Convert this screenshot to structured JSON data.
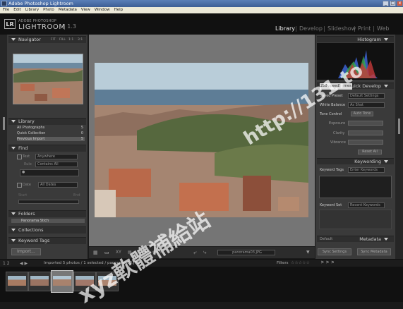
{
  "window": {
    "title": "Adobe Photoshop Lightroom"
  },
  "menu": [
    "File",
    "Edit",
    "Library",
    "Photo",
    "Metadata",
    "View",
    "Window",
    "Help"
  ],
  "brand": {
    "logo": "LR",
    "line1": "ADOBE PHOTOSHOP",
    "line2": "LIGHTROOM",
    "version": "1.3"
  },
  "modules": [
    {
      "label": "Library",
      "active": true
    },
    {
      "label": "Develop"
    },
    {
      "label": "Slideshow"
    },
    {
      "label": "Print"
    },
    {
      "label": "Web"
    }
  ],
  "navigator": {
    "title": "Navigator",
    "options": [
      "FIT",
      "FILL",
      "1:1",
      "3:1"
    ]
  },
  "library": {
    "title": "Library",
    "items": [
      {
        "label": "All Photographs",
        "count": "5"
      },
      {
        "label": "Quick Collection",
        "count": "0"
      },
      {
        "label": "Previous Import",
        "count": "5"
      }
    ]
  },
  "find": {
    "title": "Find",
    "text_label": "Text",
    "text_value": "Anywhere",
    "rule_label": "Rule",
    "rule_value": "Contains All",
    "date_label": "Date",
    "date_value": "All Dates",
    "start_label": "Start",
    "end_label": "End"
  },
  "folders": {
    "title": "Folders",
    "items": [
      "Panorama Stich"
    ]
  },
  "collections": {
    "title": "Collections"
  },
  "keyword_tags_left": {
    "title": "Keyword Tags"
  },
  "import_button": "Import...",
  "histogram": {
    "title": "Histogram"
  },
  "quick_develop": {
    "title": "Quick Develop",
    "tag": "250 speedframes",
    "saved_preset_label": "Saved Preset",
    "saved_preset_value": "Default Settings",
    "white_balance_label": "White Balance",
    "white_balance_value": "As Shot",
    "tone_control_label": "Tone Control",
    "tone_control_value": "Auto Tone",
    "sliders": [
      "Exposure",
      "Clarity",
      "Vibrance"
    ],
    "reset_label": "Reset All"
  },
  "keywording": {
    "title": "Keywording",
    "keyword_tags_label": "Keyword Tags",
    "keyword_tags_value": "Enter Keywords",
    "keyword_set_label": "Keyword Set",
    "keyword_set_value": "Recent Keywords"
  },
  "metadata": {
    "title": "Metadata",
    "preset": "Default"
  },
  "sync_settings": "Sync Settings",
  "sync_metadata": "Sync Metadata",
  "toolbar": {
    "filename": "panorama03.JPG"
  },
  "filmstrip": {
    "pages": "1  2",
    "info": "Imported 5 photos / 1 selected / panorama03.JPG",
    "filters_label": "Filters"
  },
  "watermark": {
    "text1": "http://131.to",
    "text2": "xyz軟體補給站"
  },
  "colors": {
    "panel": "#3a3a3a",
    "background": "#1a1a1a",
    "titlebar": "#3c5e95"
  }
}
